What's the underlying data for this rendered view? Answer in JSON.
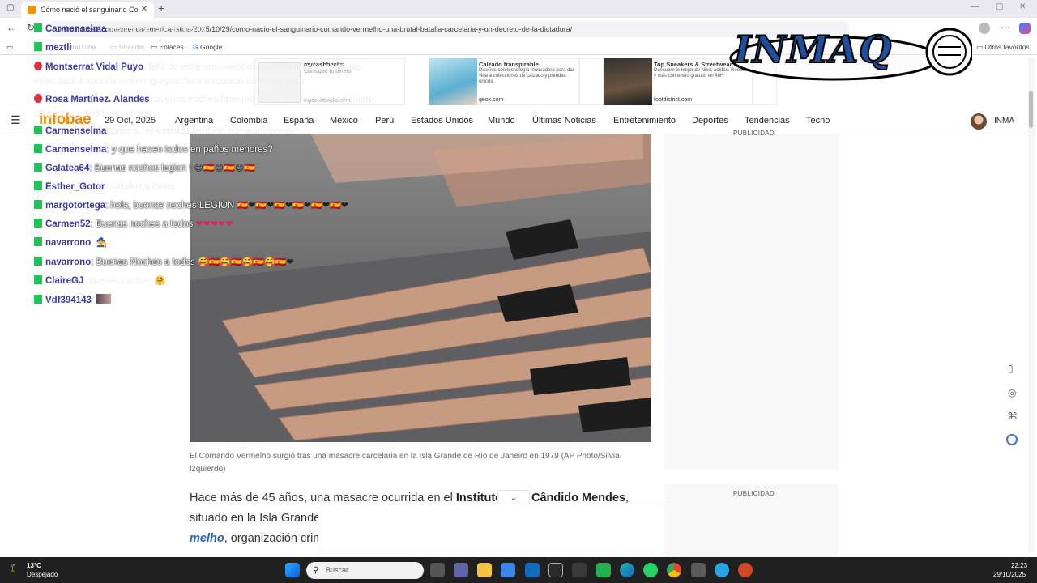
{
  "browser": {
    "tab_title": "Cómo nació el sanguinario Coma",
    "url": "www.infobae.com/america/america-latina/2025/10/29/como-nacio-el-sanguinario-comando-vermelho-una-brutal-batalla-carcelaria-y-un-decreto-de-la-dictadura/",
    "favorites": [
      "YouTube",
      "Streams",
      "Enlaces",
      "Google"
    ],
    "other_favorites": "Otros favoritos"
  },
  "ads_top": [
    {
      "title": "mycashbacks",
      "text": "Consigue tu dinero",
      "url": "mycashbacks.com"
    },
    {
      "title": "Calzado transpirable",
      "text": "Diseños con tecnología innovadora para dar vida a colecciones de calzado y prendas únicos.",
      "url": "geox.com"
    },
    {
      "title": "Top Sneakers & Streetwear",
      "text": "Descubre lo mejor de Nike, adidas, Reebok y más con envío gratuito en 48H",
      "url": "footdistrict.com"
    }
  ],
  "site": {
    "logo": "infobae",
    "date": "29 Oct, 2025",
    "nav": [
      "Argentina",
      "Colombia",
      "España",
      "México",
      "Perú",
      "Estados Unidos",
      "Mundo",
      "Últimas Noticias",
      "Entretenimiento",
      "Deportes",
      "Tendencias",
      "Tecno"
    ],
    "user": "INMA"
  },
  "article": {
    "caption": "El Comando Vermelho surgió tras una masacre carcelaria en la Isla Grande de Río de Janeiro en 1979 (AP Photo/Silvia Izquierdo)",
    "para_pre": "Hace más de 45 años, una masacre ocurrida en el ",
    "para_bold1": "Instituto",
    "para_bold2": "Cândido Mendes",
    "para_post": ",",
    "line2": "situado en la Isla Grande",
    "line3_link": "melho",
    "line3_rest": ", organización crim"
  },
  "sidebar": {
    "pub1": "PUBLICIDAD",
    "pub2": "PUBLICIDAD"
  },
  "stream_logo": "INMAQ",
  "chat": [
    {
      "user": "Carmenselma",
      "msg": ": es verdad que la gente",
      "badge": "green"
    },
    {
      "user": "meztli",
      "msg": "",
      "badge": "green"
    },
    {
      "user": "Montserrat Vidal Puyo",
      "msg": ": feliz de estar con vosotros :face-turquoise-covering-eyes::face-turquoise-covering-eyes::face-turquoise-covering-eyes:",
      "badge": "red"
    },
    {
      "user": "Rosa Martínez. Alandes",
      "msg": ": buenas noches:face-red-heart-shape::face-red-heart-shape::face-red-heart-shape:",
      "badge": "red"
    },
    {
      "user": "Carmenselma",
      "msg": ": pero si los estados también son inofensivos",
      "badge": "green"
    },
    {
      "user": "Carmenselma",
      "msg": ": y que hacen todos en paños menores?",
      "badge": "green"
    },
    {
      "user": "Galatea64",
      "msg": ": Buenas nochos legion ! ",
      "badge": "green"
    },
    {
      "user": "Esther_Gotor",
      "msg": ": saludos a todos",
      "badge": "green"
    },
    {
      "user": "margotortega",
      "msg": ": hola, buenas noches LEGIÓN",
      "badge": "green"
    },
    {
      "user": "Carmen52",
      "msg": ": Buenas noches a todos",
      "badge": "green"
    },
    {
      "user": "navarrono",
      "msg": ":",
      "badge": "green"
    },
    {
      "user": "navarrono",
      "msg": ": Buenas Noches a todos",
      "badge": "green"
    },
    {
      "user": "ClaireGJ",
      "msg": ": buenas noches",
      "badge": "green"
    },
    {
      "user": "Vdf394143",
      "msg": ":",
      "badge": "green"
    }
  ],
  "taskbar": {
    "weather_temp": "13°C",
    "weather_desc": "Despejado",
    "search_placeholder": "Buscar",
    "time": "22:23",
    "date": "29/10/2025"
  },
  "colors": {
    "infobae_orange": "#f08a00",
    "chat_user": "#3a3aa8",
    "badge_green": "#22c25a",
    "badge_red": "#d9323c"
  }
}
